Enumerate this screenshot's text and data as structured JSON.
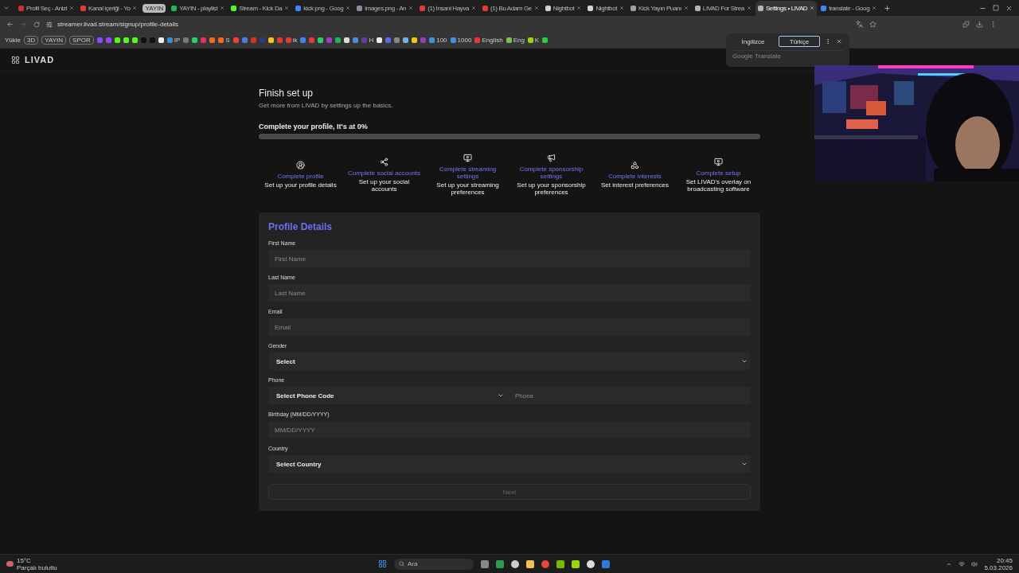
{
  "browser": {
    "tabs": [
      {
        "kind": "tab",
        "title": "Profil Seç - Anizi",
        "color": "#d32f2f",
        "selected": false
      },
      {
        "kind": "tab",
        "title": "Kanal içeriği - Yo",
        "color": "#e53935",
        "selected": false
      },
      {
        "kind": "group",
        "title": "YAYIN"
      },
      {
        "kind": "tab",
        "title": "YAYIN - playlist",
        "color": "#1db954",
        "selected": false
      },
      {
        "kind": "tab",
        "title": "Stream - Kick Da",
        "color": "#53fc18",
        "selected": false
      },
      {
        "kind": "tab",
        "title": "kick png - Goog",
        "color": "#4285f4",
        "selected": false
      },
      {
        "kind": "tab",
        "title": "images.png - An",
        "color": "#8a8fa0",
        "selected": false
      },
      {
        "kind": "tab",
        "title": "(1) İnsani Hayva",
        "color": "#e53935",
        "selected": false
      },
      {
        "kind": "tab",
        "title": "(1) Bu Adam Ge",
        "color": "#e53935",
        "selected": false
      },
      {
        "kind": "tab",
        "title": "Nightbot",
        "color": "#cfd3da",
        "selected": false
      },
      {
        "kind": "tab",
        "title": "Nightbot",
        "color": "#cfd3da",
        "selected": false
      },
      {
        "kind": "tab",
        "title": "Kick Yayın Puanı",
        "color": "#9aa0a6",
        "selected": false
      },
      {
        "kind": "tab",
        "title": "LIVAD For Strea",
        "color": "#b0b4bb",
        "selected": false
      },
      {
        "kind": "tab",
        "title": "Settings • LIVAD",
        "color": "#b0b4bb",
        "selected": true
      },
      {
        "kind": "tab",
        "title": "translate - Goog",
        "color": "#4285f4",
        "selected": false
      }
    ],
    "url": "streamer.livad.stream/signup/profile-details",
    "bookmarks": [
      {
        "kind": "text",
        "label": "Yükle"
      },
      {
        "kind": "pill",
        "label": "3D"
      },
      {
        "kind": "pill",
        "label": "YAYIN"
      },
      {
        "kind": "pill",
        "label": "SPOR"
      },
      {
        "kind": "icon",
        "color": "#9146ff"
      },
      {
        "kind": "icon",
        "color": "#9146ff"
      },
      {
        "kind": "icon",
        "color": "#53fc18"
      },
      {
        "kind": "icon",
        "color": "#53fc18"
      },
      {
        "kind": "icon",
        "color": "#53fc18"
      },
      {
        "kind": "icon",
        "color": "#111111"
      },
      {
        "kind": "icon",
        "color": "#111111"
      },
      {
        "kind": "icon",
        "color": "#eeeeee"
      },
      {
        "kind": "icon",
        "color": "#3b8bd9",
        "label": "IP"
      },
      {
        "kind": "icon",
        "color": "#777777"
      },
      {
        "kind": "icon",
        "color": "#25d366"
      },
      {
        "kind": "icon",
        "color": "#e1306c"
      },
      {
        "kind": "icon",
        "color": "#f26b21"
      },
      {
        "kind": "icon",
        "color": "#f26b21",
        "label": "S"
      },
      {
        "kind": "icon",
        "color": "#ea4335"
      },
      {
        "kind": "icon",
        "color": "#4a7fe0"
      },
      {
        "kind": "icon",
        "color": "#d9302b"
      },
      {
        "kind": "icon",
        "color": "#2a3a8c"
      },
      {
        "kind": "icon",
        "color": "#f5c518"
      },
      {
        "kind": "icon",
        "color": "#e53935"
      },
      {
        "kind": "icon",
        "color": "#e53935",
        "label": "ik"
      },
      {
        "kind": "icon",
        "color": "#4285f4"
      },
      {
        "kind": "icon",
        "color": "#e53935"
      },
      {
        "kind": "icon",
        "color": "#2ecc71"
      },
      {
        "kind": "icon",
        "color": "#a23dbd"
      },
      {
        "kind": "icon",
        "color": "#1db954"
      },
      {
        "kind": "icon",
        "color": "#dddddd"
      },
      {
        "kind": "icon",
        "color": "#4a90e2"
      },
      {
        "kind": "icon",
        "color": "#6a3d9a",
        "label": "H"
      },
      {
        "kind": "icon",
        "color": "#eeeeee"
      },
      {
        "kind": "icon",
        "color": "#5b6ee1"
      },
      {
        "kind": "icon",
        "color": "#888888"
      },
      {
        "kind": "icon",
        "color": "#6fb3e0"
      },
      {
        "kind": "icon",
        "color": "#f5c518"
      },
      {
        "kind": "icon",
        "color": "#8e44ad"
      },
      {
        "kind": "icon",
        "color": "#4a90e2",
        "label": "100"
      },
      {
        "kind": "icon",
        "color": "#4a90e2",
        "label": "1000"
      },
      {
        "kind": "icon",
        "color": "#e53935",
        "label": "English"
      },
      {
        "kind": "icon",
        "color": "#7cc242",
        "label": "Eng"
      },
      {
        "kind": "icon",
        "color": "#9ad40f",
        "label": "K"
      },
      {
        "kind": "icon",
        "color": "#2ecc40"
      }
    ],
    "translate_popup": {
      "options": [
        {
          "label": "İngilizce",
          "selected": false
        },
        {
          "label": "Türkçe",
          "selected": true
        }
      ],
      "footer": "Google Translate"
    }
  },
  "page": {
    "logo": "LIVAD",
    "title": "Finish set up",
    "subtitle": "Get more from LIVAD by settings up the basics.",
    "progress": {
      "label": "Complete your profile, It's at 0%",
      "level": 0
    },
    "steps": [
      {
        "kind": "profile",
        "title": "Complete profile",
        "description": "Set up your profile details"
      },
      {
        "kind": "social",
        "title": "Complete social accounts",
        "description": "Set up your social accounts"
      },
      {
        "kind": "streaming",
        "title": "Complete streaming settings",
        "description": "Set up your streaming preferences"
      },
      {
        "kind": "sponsorship",
        "title": "Complete sponsorship settings",
        "description": "Set up your sponsorship preferences"
      },
      {
        "kind": "interests",
        "title": "Complete interests",
        "description": "Set interest preferences"
      },
      {
        "kind": "setup",
        "title": "Complete setup",
        "description": "Set LIVAD's overlay on broadcasting software"
      }
    ],
    "form": {
      "title": "Profile Details",
      "fields": [
        {
          "kind": "text",
          "label": "First Name",
          "placeholder": "First Name"
        },
        {
          "kind": "text",
          "label": "Last Name",
          "placeholder": "Last Name"
        },
        {
          "kind": "text",
          "label": "Email",
          "placeholder": "Email"
        },
        {
          "kind": "select",
          "label": "Gender",
          "value": "Select"
        },
        {
          "kind": "phone",
          "label": "Phone",
          "value": "Select Phone Code",
          "placeholder": "Phone"
        },
        {
          "kind": "text",
          "label": "Birthday (MM/DD/YYYY)",
          "placeholder": "MM/DD/YYYY"
        },
        {
          "kind": "select",
          "label": "Country",
          "value": "Select Country"
        }
      ],
      "submit": {
        "label": "Next",
        "disabled": true
      }
    }
  },
  "taskbar": {
    "temperature": "15°C",
    "condition": "Parçalı bulutlu",
    "search_placeholder": "Ara",
    "time": "20:45",
    "date": "5.03.2026"
  }
}
